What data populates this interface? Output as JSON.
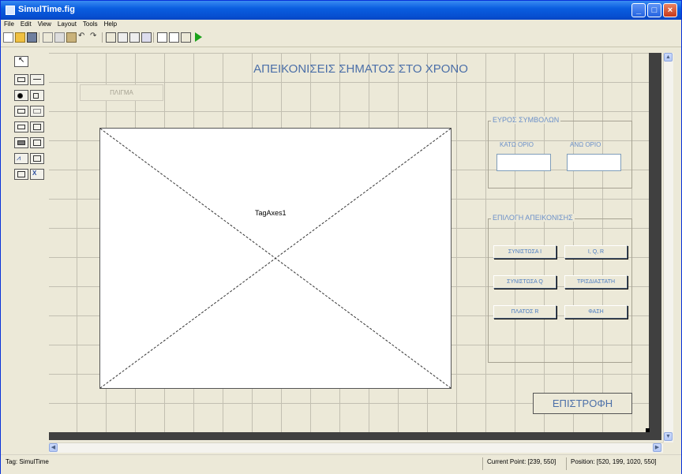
{
  "window": {
    "title": "SimulTime.fig"
  },
  "menu": [
    "File",
    "Edit",
    "View",
    "Layout",
    "Tools",
    "Help"
  ],
  "toolbar": {
    "icons": [
      "new-file-icon",
      "open-folder-icon",
      "save-icon",
      "cut-icon",
      "copy-icon",
      "paste-icon",
      "undo-icon",
      "redo-icon",
      "align-icon",
      "menu-editor-icon",
      "tab-order-icon",
      "toolbar-editor-icon",
      "mfile-editor-icon",
      "property-inspector-icon",
      "object-browser-icon",
      "run-icon"
    ]
  },
  "palette": {
    "tools": [
      "select-tool-icon",
      "push-button-tool-icon",
      "slider-tool-icon",
      "radio-button-tool-icon",
      "checkbox-tool-icon",
      "edit-text-tool-icon",
      "static-text-tool-icon",
      "popup-menu-tool-icon",
      "listbox-tool-icon",
      "toggle-button-tool-icon",
      "table-tool-icon",
      "axes-tool-icon",
      "panel-tool-icon",
      "button-group-tool-icon",
      "activex-tool-icon"
    ]
  },
  "figure": {
    "heading": "ΑΠΕΙΚΟΝΙΣΕΙΣ ΣΗΜΑΤΟΣ ΣΤΟ ΧΡΟΝΟ",
    "top_button": "ΠΛΙΓΜΑ",
    "axes_tag": "TagAxes1",
    "range_panel": {
      "title": "ΕΥΡΟΣ ΣΥΜΒΟΛΩΝ",
      "lower_label": "ΚΑΤΩ ΟΡΙΟ",
      "upper_label": "ΑΝΩ ΟΡΙΟ"
    },
    "display_panel": {
      "title": "ΕΠΙΛΟΓΗ ΑΠΕΙΚΟΝΙΣΗΣ",
      "buttons": [
        "ΣΥΝΙΣΤΩΣΑ Ι",
        "Ι, Q, R",
        "ΣΥΝΙΣΤΩΣΑ Q",
        "ΤΡΙΣΔΙΑΣΤΑΤΗ",
        "ΠΛΑΤΟΣ R",
        "ΦΑΣΗ"
      ]
    },
    "back_button": "ΕΠΙΣΤΡΟΦΗ"
  },
  "status": {
    "tag": "Tag: SimulTime",
    "current_point": "Current Point:  [239, 550]",
    "position": "Position: [520, 199, 1020, 550]"
  },
  "colors": {
    "titlebar": "#0a5ee0",
    "accent_text": "#4b6fa8",
    "canvas": "#ece9d8"
  }
}
